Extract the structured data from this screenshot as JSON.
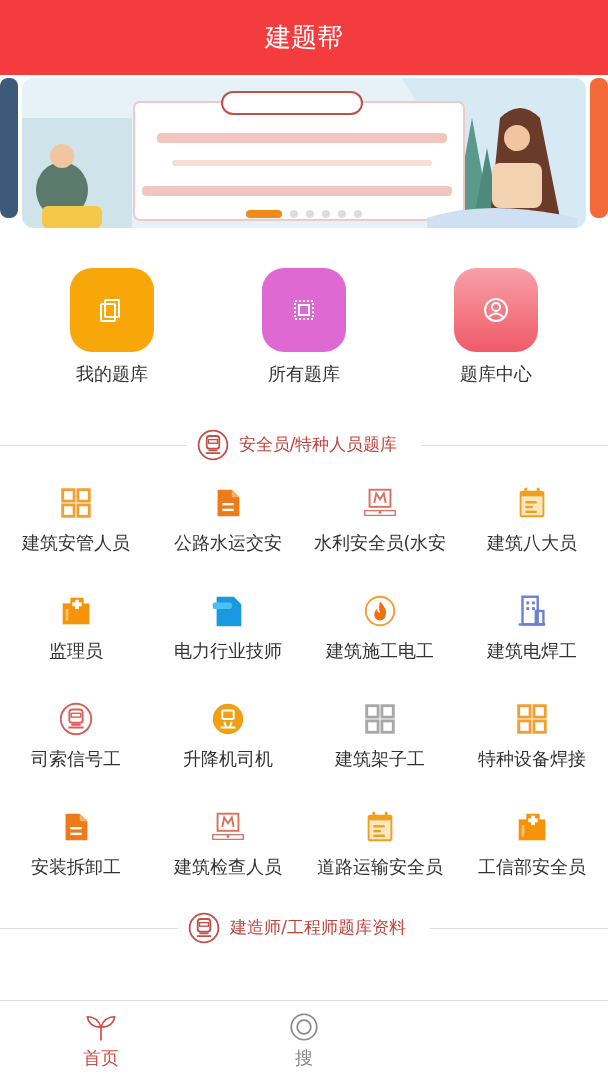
{
  "header": {
    "title": "建题帮"
  },
  "banner": {
    "slides": [
      {
        "selected": true
      },
      {
        "selected": false
      },
      {
        "selected": false
      },
      {
        "selected": false
      },
      {
        "selected": false
      },
      {
        "selected": false
      }
    ]
  },
  "quick_links": [
    {
      "label": "我的题库"
    },
    {
      "label": "所有题库"
    },
    {
      "label": "题库中心"
    }
  ],
  "sections": [
    {
      "title": "安全员/特种人员题库",
      "items": [
        {
          "label": "建筑安管人员"
        },
        {
          "label": "公路水运交安"
        },
        {
          "label": "水利安全员(水安"
        },
        {
          "label": "建筑八大员"
        },
        {
          "label": "监理员"
        },
        {
          "label": "电力行业技师"
        },
        {
          "label": "建筑施工电工"
        },
        {
          "label": "建筑电焊工"
        },
        {
          "label": "司索信号工"
        },
        {
          "label": "升降机司机"
        },
        {
          "label": "建筑架子工"
        },
        {
          "label": "特种设备焊接"
        },
        {
          "label": "安装拆卸工"
        },
        {
          "label": "建筑检查人员"
        },
        {
          "label": "道路运输安全员"
        },
        {
          "label": "工信部安全员"
        }
      ]
    },
    {
      "title": "建造师/工程师题库资料"
    }
  ],
  "tab_bar": [
    {
      "label": "首页",
      "selected": true
    },
    {
      "label": "搜",
      "selected": false
    }
  ]
}
